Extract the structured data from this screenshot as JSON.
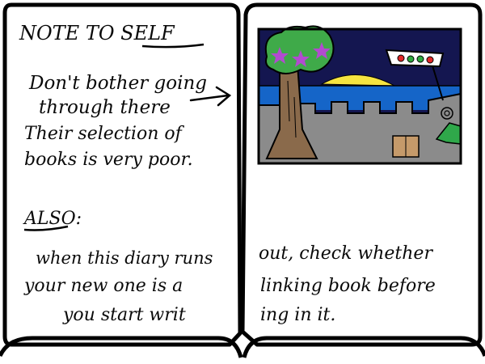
{
  "note": {
    "heading": "NOTE TO SELF",
    "lines": [
      "Don't bother going",
      "through there",
      "Their selection of",
      "books is very poor."
    ],
    "also_label": "ALSO:"
  },
  "spread": {
    "lines": [
      {
        "left": "when this diary runs",
        "right": "out, check whether"
      },
      {
        "left": "your new one is a",
        "right": "linking book before"
      },
      {
        "left": "you start writ",
        "right": "ing in it."
      }
    ]
  },
  "painting": {
    "colors": {
      "sky": "#141650",
      "sea": "#1565c8",
      "sun": "#f6e440",
      "wall": "#8b8b8b",
      "tree_trunk": "#8a6a4b",
      "foliage": "#3faa49",
      "star": "#b24bd0",
      "bush": "#2fa84a",
      "crate": "#c59a6a",
      "flag_red": "#e02828",
      "flag_green": "#2faa3f"
    }
  }
}
